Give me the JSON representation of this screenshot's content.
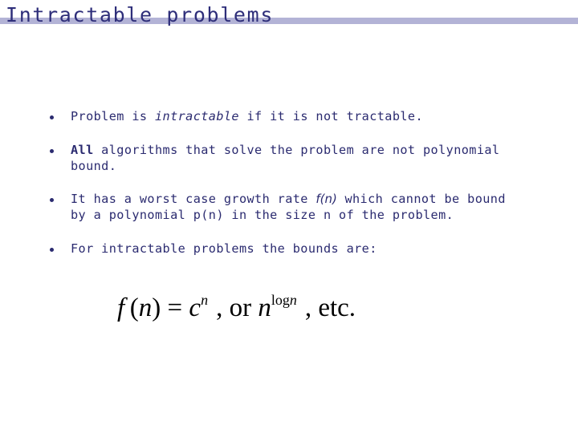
{
  "slide": {
    "title": "Intractable problems",
    "accent_bar_color": "#b3b3d6",
    "text_color": "#2b2b70"
  },
  "bullets": [
    {
      "parts": [
        {
          "text": "Problem is ",
          "style": "normal"
        },
        {
          "text": "intractable",
          "style": "italic"
        },
        {
          "text": " if it is not tractable.",
          "style": "normal"
        }
      ]
    },
    {
      "parts": [
        {
          "text": "All",
          "style": "bold"
        },
        {
          "text": " algorithms that solve the problem are not polynomial",
          "style": "normal"
        },
        {
          "text": "bound.",
          "style": "normal"
        }
      ]
    },
    {
      "parts": [
        {
          "text": "It has a worst case growth rate ",
          "style": "normal"
        },
        {
          "text": "f(n)",
          "style": "math-italic"
        },
        {
          "text": " which cannot be bound",
          "style": "normal"
        },
        {
          "text": "by a polynomial p(n) in the size n of the problem.",
          "style": "normal"
        }
      ]
    },
    {
      "parts": [
        {
          "text": "For intractable problems the bounds are:",
          "style": "normal"
        }
      ]
    }
  ],
  "formula": {
    "lhs_func": "f",
    "lhs_arg_open": "(",
    "lhs_arg": "n",
    "lhs_arg_close": ")",
    "equals": "=",
    "base1": "c",
    "exp1": "n",
    "sep1": ", or",
    "base2": "n",
    "exp2_func": "log",
    "exp2_var": "n",
    "tail": ", etc."
  }
}
